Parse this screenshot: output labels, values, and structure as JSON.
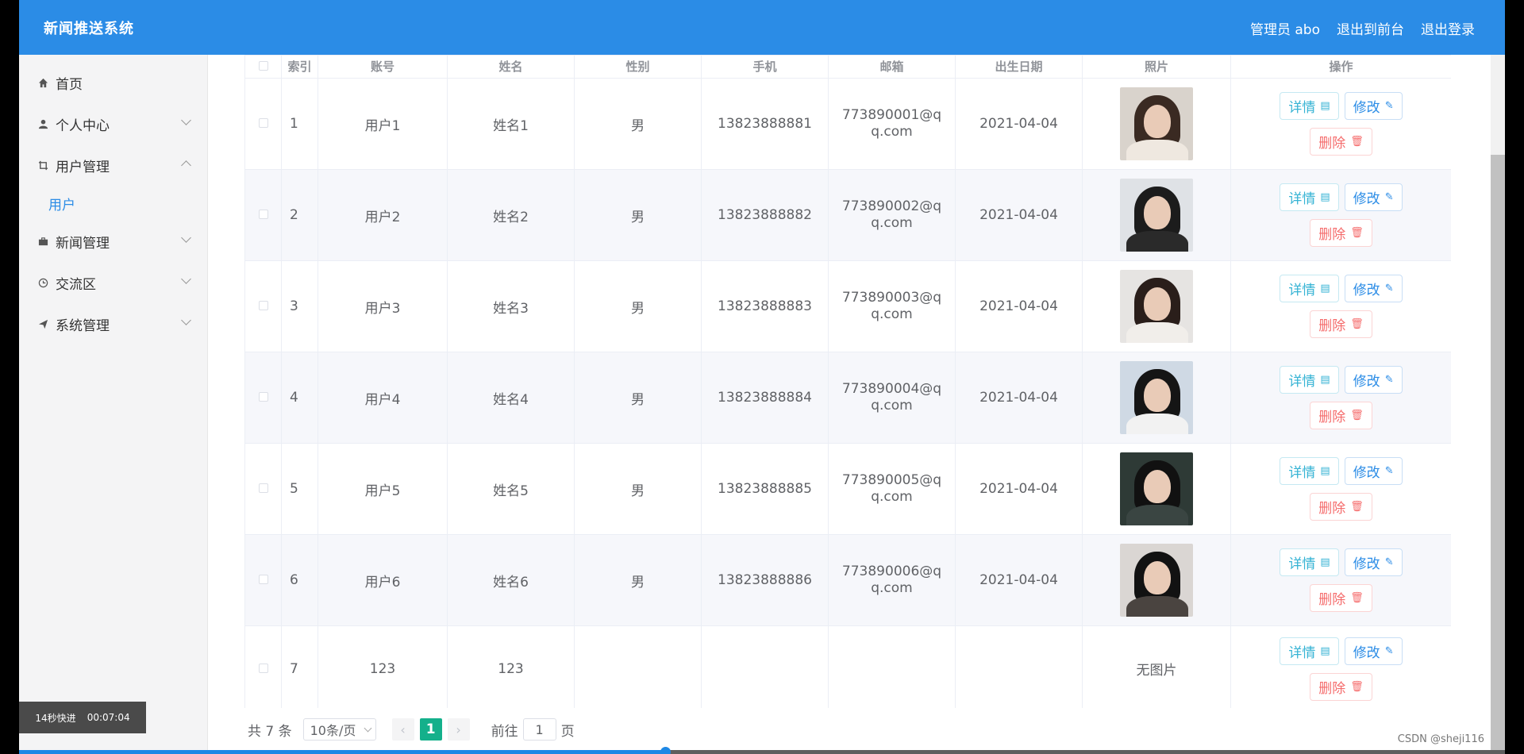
{
  "header": {
    "title": "新闻推送系统",
    "admin_label": "管理员 abo",
    "to_front": "退出到前台",
    "logout": "退出登录"
  },
  "sidebar": {
    "items": [
      {
        "label": "首页",
        "icon": "home-icon"
      },
      {
        "label": "个人中心",
        "icon": "user-icon"
      },
      {
        "label": "用户管理",
        "icon": "crop-icon",
        "expanded": true,
        "children": [
          {
            "label": "用户"
          }
        ]
      },
      {
        "label": "新闻管理",
        "icon": "briefcase-icon"
      },
      {
        "label": "交流区",
        "icon": "clock-icon"
      },
      {
        "label": "系统管理",
        "icon": "send-icon"
      }
    ]
  },
  "table": {
    "columns": [
      "索引",
      "账号",
      "姓名",
      "性别",
      "手机",
      "邮箱",
      "出生日期",
      "照片",
      "操作"
    ],
    "rows": [
      {
        "index": "1",
        "account": "用户1",
        "name": "姓名1",
        "gender": "男",
        "phone": "13823888881",
        "email": "773890001@qq.com",
        "birthday": "2021-04-04",
        "photo": "portrait-1"
      },
      {
        "index": "2",
        "account": "用户2",
        "name": "姓名2",
        "gender": "男",
        "phone": "13823888882",
        "email": "773890002@qq.com",
        "birthday": "2021-04-04",
        "photo": "portrait-2"
      },
      {
        "index": "3",
        "account": "用户3",
        "name": "姓名3",
        "gender": "男",
        "phone": "13823888883",
        "email": "773890003@qq.com",
        "birthday": "2021-04-04",
        "photo": "portrait-3"
      },
      {
        "index": "4",
        "account": "用户4",
        "name": "姓名4",
        "gender": "男",
        "phone": "13823888884",
        "email": "773890004@qq.com",
        "birthday": "2021-04-04",
        "photo": "portrait-4"
      },
      {
        "index": "5",
        "account": "用户5",
        "name": "姓名5",
        "gender": "男",
        "phone": "13823888885",
        "email": "773890005@qq.com",
        "birthday": "2021-04-04",
        "photo": "portrait-5"
      },
      {
        "index": "6",
        "account": "用户6",
        "name": "姓名6",
        "gender": "男",
        "phone": "13823888886",
        "email": "773890006@qq.com",
        "birthday": "2021-04-04",
        "photo": "portrait-6"
      },
      {
        "index": "7",
        "account": "123",
        "name": "123",
        "gender": "",
        "phone": "",
        "email": "",
        "birthday": "",
        "photo": "",
        "no_photo_text": "无图片"
      }
    ],
    "actions": {
      "detail": "详情",
      "edit": "修改",
      "delete": "删除"
    }
  },
  "pager": {
    "total": "共 7 条",
    "page_size": "10条/页",
    "current_page": "1",
    "goto_label": "前往",
    "goto_value": "1",
    "page_suffix": "页"
  },
  "video_overlay": {
    "speed": "14秒快进",
    "time": "00:07:04"
  },
  "watermark": "CSDN @sheji116",
  "colors": {
    "header": "#2b8ce6",
    "active_page": "#14b08b",
    "delete": "#f56c6c",
    "detail": "#35b3d4"
  }
}
